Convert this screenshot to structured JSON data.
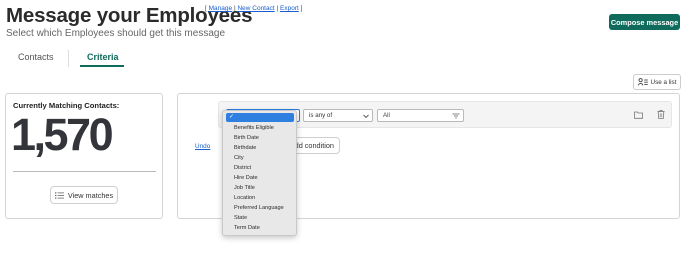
{
  "header": {
    "title": "Message your Employees",
    "links_open": "[",
    "links": [
      "Manage",
      "New Contact",
      "Export"
    ],
    "links_close": "]",
    "subtitle": "Select which Employees should get this message",
    "compose_label": "Compose message"
  },
  "tabs": [
    {
      "label": "Contacts",
      "active": false
    },
    {
      "label": "Criteria",
      "active": true
    }
  ],
  "use_list_label": "Use a list",
  "matching": {
    "label": "Currently Matching Contacts:",
    "count": "1,570",
    "view_label": "View matches"
  },
  "criteria": {
    "field_dropdown": {
      "selected_marker": "✓",
      "options": [
        "Benefits Eligible",
        "Birth Date",
        "Birthdate",
        "City",
        "District",
        "Hire Date",
        "Job Title",
        "Location",
        "Preferred Language",
        "State",
        "Term Date"
      ]
    },
    "operator_value": "is any of",
    "value_placeholder": "All",
    "undo_label": "Undo",
    "add_condition_label": "Add condition"
  },
  "colors": {
    "accent": "#0f6b5c",
    "link": "#1a5fd0",
    "selection": "#2f7fe0"
  }
}
